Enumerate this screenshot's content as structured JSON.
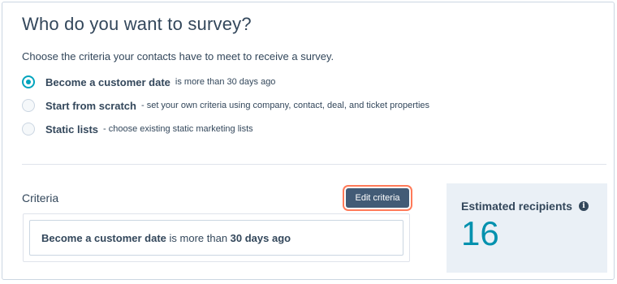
{
  "title": "Who do you want to survey?",
  "subtitle": "Choose the criteria your contacts have to meet to receive a survey.",
  "options": [
    {
      "label": "Become a customer date",
      "desc": "is more than 30 days ago",
      "checked": true
    },
    {
      "label": "Start from scratch",
      "desc": "- set your own criteria using company, contact, deal, and ticket properties",
      "checked": false
    },
    {
      "label": "Static lists",
      "desc": "- choose existing static marketing lists",
      "checked": false
    }
  ],
  "criteria": {
    "label": "Criteria",
    "edit_button": "Edit criteria",
    "summary_property": "Become a customer date",
    "summary_operator": " is more than ",
    "summary_value": "30 days ago"
  },
  "recipients": {
    "label": "Estimated recipients",
    "count": "16",
    "info_icon": "info-icon"
  },
  "colors": {
    "accent": "#00a4bd",
    "count": "#0091ae",
    "button": "#425b76",
    "focus_ring": "#ff7a59",
    "panel": "#eaf0f6"
  }
}
